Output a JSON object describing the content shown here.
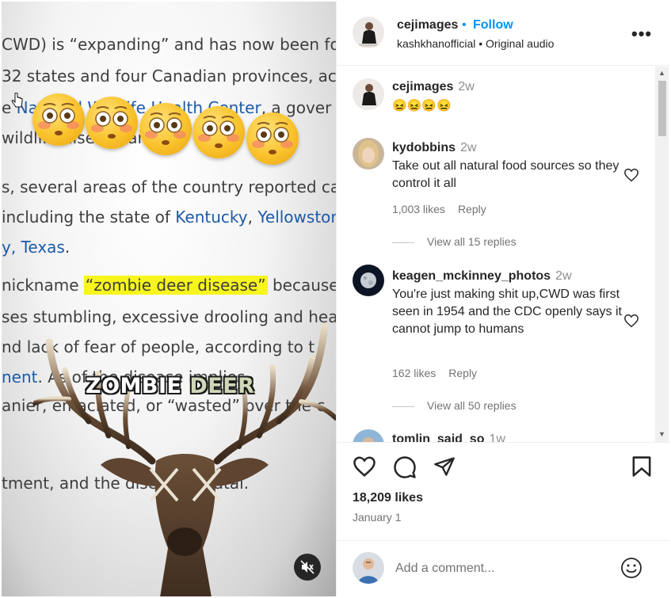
{
  "video": {
    "article_lines": [
      {
        "pre": "CWD) is “expanding” and has now been fou",
        "link": "",
        "post": "",
        "hl": ""
      },
      {
        "pre": "32 states and four Canadian provinces, ac",
        "link": "",
        "post": "",
        "hl": ""
      },
      {
        "pre": "e ",
        "link": "National Wildlife Health Center",
        "post": ", a gover",
        "hl": ""
      },
      {
        "pre": " wildlife disease and pro",
        "link": "",
        "post": "",
        "hl": ""
      },
      {
        "pre": "s, several areas of the country reported cas",
        "link": "",
        "post": "",
        "hl": ""
      },
      {
        "pre": "including the state of ",
        "link": "Kentucky",
        "post": ", ",
        "link2": "Yellowstor"
      },
      {
        "pre": "",
        "link": "y, Texas",
        "post": ".",
        "hl": ""
      },
      {
        "pre": "nickname ",
        "link": "",
        "hl": "“zombie deer disease”",
        "post": " because it"
      },
      {
        "pre": "ses stumbling, excessive drooling and head",
        "link": "",
        "post": "",
        "hl": ""
      },
      {
        "pre": "nd lack of fear of people, according to t",
        "link": "",
        "post": "",
        "hl": ""
      },
      {
        "pre": "",
        "link": "nent",
        "post": ". As    of the disease implies",
        "hl": ""
      },
      {
        "pre": "anier, emaciated, or “wasted” over the c",
        "link": "",
        "post": "",
        "hl": ""
      },
      {
        "pre": "tment, and the disease is fatal.",
        "link": "",
        "post": "",
        "hl": ""
      }
    ],
    "overlay_title_part1": "ZOMBIE ",
    "overlay_title_part2": "DEER",
    "emoji_count": 5,
    "mute_icon": "speaker-muted-icon"
  },
  "post": {
    "author": "cejimages",
    "dot": "•",
    "follow_label": "Follow",
    "subline": "kashkhanofficial • Original audio",
    "more_label": "•••"
  },
  "comments": [
    {
      "user": "cejimages",
      "time": "2w",
      "text": "😖😖😖😖"
    },
    {
      "user": "kydobbins",
      "time": "2w",
      "text": "Take out all natural food sources so they control it all",
      "likes": "1,003 likes",
      "reply": "Reply",
      "replies": "View all 15 replies"
    },
    {
      "user": "keagen_mckinney_photos",
      "time": "2w",
      "text": "You're just making shit up,CWD was first seen in 1954 and the CDC openly says it cannot jump to humans",
      "likes": "162 likes",
      "reply": "Reply",
      "replies": "View all 50 replies"
    },
    {
      "user": "tomlin_said_so",
      "time": "1w"
    }
  ],
  "actions": {
    "likes": "18,209 likes",
    "date": "January 1"
  },
  "add_comment": {
    "placeholder": "Add a comment..."
  },
  "colors": {
    "accent": "#0095f6",
    "highlight": "#f7f51b",
    "link": "#1c5aa8"
  }
}
